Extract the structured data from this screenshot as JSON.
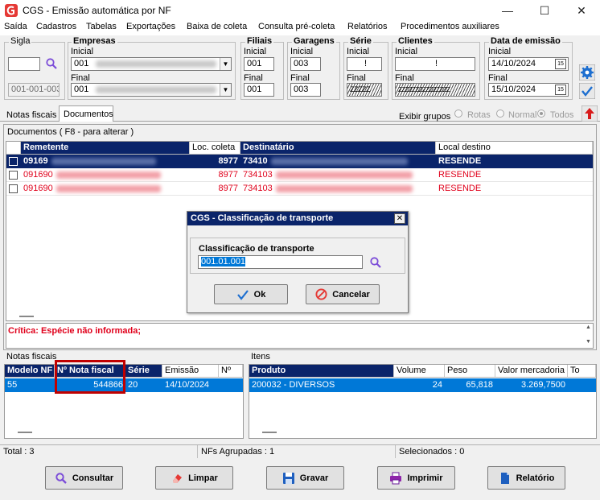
{
  "window": {
    "title": "CGS - Emissão automática por NF",
    "minimize_glyph": "—",
    "maximize_glyph": "☐",
    "close_glyph": "✕"
  },
  "menu": [
    "Saída",
    "Cadastros",
    "Tabelas",
    "Exportações",
    "Baixa de coleta",
    "Consulta pré-coleta",
    "Relatórios",
    "Procedimentos auxiliares"
  ],
  "filters": {
    "sigla": {
      "title": "Sigla",
      "value": "",
      "range": "001-001-003"
    },
    "empresas": {
      "title": "Empresas",
      "inicial_label": "Inicial",
      "inicial": "001",
      "final_label": "Final",
      "final": "001"
    },
    "filiais": {
      "title": "Filiais",
      "inicial_label": "Inicial",
      "inicial": "001",
      "final_label": "Final",
      "final": "001"
    },
    "garagens": {
      "title": "Garagens",
      "inicial_label": "Inicial",
      "inicial": "003",
      "final_label": "Final",
      "final": "003"
    },
    "serie": {
      "title": "Série",
      "inicial_label": "Inicial",
      "inicial": "!",
      "final_label": "Final",
      "final": "ZZZZZ"
    },
    "clientes": {
      "title": "Clientes",
      "inicial_label": "Inicial",
      "inicial": "!",
      "final_label": "Final",
      "final": "ZZZZZZZZZZZZZZZ"
    },
    "data_emissao": {
      "title": "Data de emissão",
      "inicial_label": "Inicial",
      "inicial": "14/10/2024",
      "final_label": "Final",
      "final": "15/10/2024",
      "calendar_glyph": "15"
    }
  },
  "tabs": [
    "Notas fiscais",
    "Documentos"
  ],
  "exibir_grupos": {
    "label": "Exibir grupos",
    "options": [
      "Rotas",
      "Normal",
      "Todos"
    ]
  },
  "documentos": {
    "title": "Documentos ( F8 - para alterar )",
    "columns": [
      "Remetente",
      "Loc. coleta",
      "Destinatário",
      "Local destino"
    ],
    "rows": [
      {
        "remetente": "09169",
        "loc_coleta": "8977",
        "destinatario": "73410",
        "local_destino": "RESENDE"
      },
      {
        "remetente": "091690",
        "loc_coleta": "8977",
        "destinatario": "734103",
        "local_destino": "RESENDE"
      },
      {
        "remetente": "091690",
        "loc_coleta": "8977",
        "destinatario": "734103",
        "local_destino": "RESENDE"
      }
    ]
  },
  "critica": "Crítica: Espécie não informada;",
  "notas_fiscais": {
    "title": "Notas fiscais",
    "columns": [
      "Modelo NF",
      "Nº Nota fiscal",
      "Série",
      "Emissão",
      "Nº"
    ],
    "rows": [
      {
        "modelo": "55",
        "numero": "544866",
        "serie": "20",
        "emissao": "14/10/2024",
        "n": ""
      }
    ]
  },
  "itens": {
    "title": "Itens",
    "columns": [
      "Produto",
      "Volume",
      "Peso",
      "Valor mercadoria",
      "To"
    ],
    "rows": [
      {
        "produto": "200032 - DIVERSOS",
        "volume": "24",
        "peso": "65,818",
        "valor": "3.269,7500",
        "to": ""
      }
    ]
  },
  "dialog": {
    "title": "CGS - Classificação de transporte",
    "close_glyph": "✕",
    "field_label": "Classificação de transporte",
    "field_value": "001.01.001",
    "ok_label": "Ok",
    "cancel_label": "Cancelar"
  },
  "status": {
    "total": "Total : 3",
    "agrupadas": "NFs Agrupadas : 1",
    "selecionados": "Selecionados : 0"
  },
  "buttons": {
    "consultar": "Consultar",
    "limpar": "Limpar",
    "gravar": "Gravar",
    "imprimir": "Imprimir",
    "relatorio": "Relatório"
  },
  "colors": {
    "selection": "#0a246a",
    "critical_red": "#e0001b",
    "row_red": "#e0001b",
    "highlight_border": "#c00000",
    "item_selection": "#0078d7"
  }
}
